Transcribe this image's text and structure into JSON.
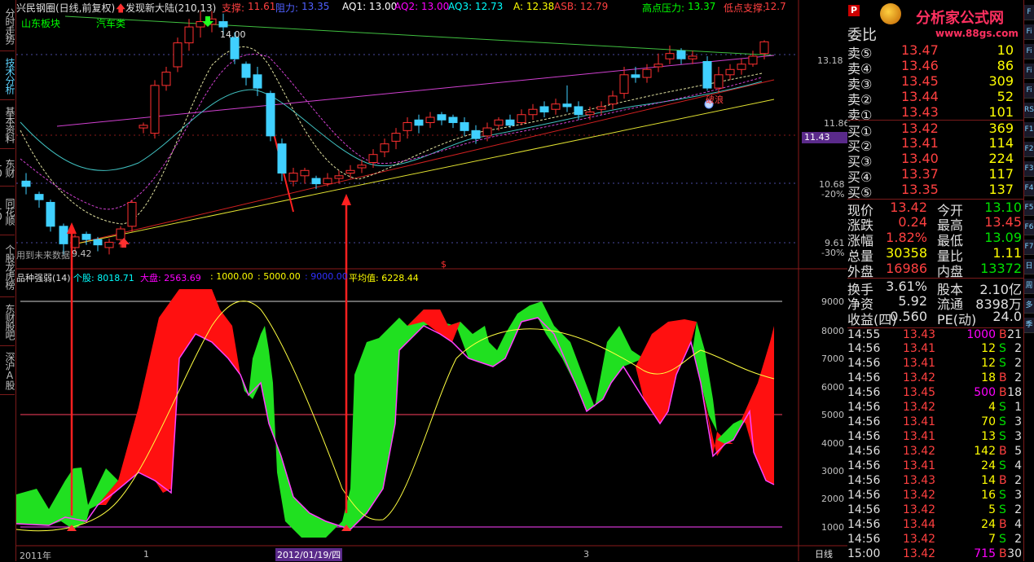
{
  "title": {
    "stock": "兴民钢圈(日线,前复权)",
    "indicator": "发现新大陆(210,13)",
    "support_label": "支撑:",
    "support_val": "11.61",
    "resist_label": "阻力:",
    "resist_val": "13.35",
    "aq1": "AQ1: 13.00",
    "aq2": "AQ2: 13.00",
    "aq3": "AQ3: 12.73",
    "a": "A: 12.38",
    "asb": "ASB: 12.79",
    "high_label": "高点压力:",
    "high_val": "13.37",
    "low_label": "低点支撑:",
    "low_val": "12.7"
  },
  "sector": [
    "山东板块",
    "汽车类"
  ],
  "left_tabs": [
    "分时走势",
    "技术分析",
    "基本资料",
    "东财10",
    "同花顺10",
    "个股龙虎榜",
    "东财股吧",
    "深沪A股"
  ],
  "main_chart": {
    "price_labels": [
      "13.18",
      "11.86",
      "10.68",
      "-20%",
      "9.61",
      "-30%"
    ],
    "current_price": "11.43",
    "peak_label": "14.00",
    "low_label": "9.42",
    "annot_bottom": "用到未来数据",
    "annot_right": "破浪"
  },
  "sub_chart": {
    "header": "品种强弱(14)",
    "stock_lbl": "个股: 8018.71",
    "market_lbl": "大盘: 2563.69",
    "l1000": ": 1000.00",
    "l5000": ": 5000.00",
    "l9000": ": 9000.00",
    "avg_lbl": "平均值: 6228.44",
    "y_labels": [
      "9000",
      "8000",
      "7000",
      "6000",
      "5000",
      "4000",
      "3000",
      "2000",
      "1000"
    ]
  },
  "x_axis": {
    "labels": [
      "2011年",
      "1",
      "2012/01/19/四",
      "3"
    ],
    "period": "日线"
  },
  "logo": {
    "brand": "分析家公式网",
    "url": "www.88gs.com",
    "badge": "P"
  },
  "orderbook": {
    "header": "委比",
    "sells": [
      {
        "label": "卖⑤",
        "price": "13.47",
        "vol": "10"
      },
      {
        "label": "卖④",
        "price": "13.46",
        "vol": "86"
      },
      {
        "label": "卖③",
        "price": "13.45",
        "vol": "309"
      },
      {
        "label": "卖②",
        "price": "13.44",
        "vol": "52"
      },
      {
        "label": "卖①",
        "price": "13.43",
        "vol": "101"
      }
    ],
    "buys": [
      {
        "label": "买①",
        "price": "13.42",
        "vol": "369"
      },
      {
        "label": "买②",
        "price": "13.41",
        "vol": "114"
      },
      {
        "label": "买③",
        "price": "13.40",
        "vol": "224"
      },
      {
        "label": "买④",
        "price": "13.37",
        "vol": "117"
      },
      {
        "label": "买⑤",
        "price": "13.35",
        "vol": "137"
      }
    ]
  },
  "quote": [
    {
      "l1": "现价",
      "v1": "13.42",
      "l2": "今开",
      "v2": "13.10"
    },
    {
      "l1": "涨跌",
      "v1": "0.24",
      "l2": "最高",
      "v2": "13.45"
    },
    {
      "l1": "涨幅",
      "v1": "1.82%",
      "l2": "最低",
      "v2": "13.09"
    },
    {
      "l1": "总量",
      "v1": "30358",
      "l2": "量比",
      "v2": "1.11"
    },
    {
      "l1": "外盘",
      "v1": "16986",
      "l2": "内盘",
      "v2": "13372"
    }
  ],
  "stats": [
    {
      "l1": "换手",
      "v1": "3.61%",
      "l2": "股本",
      "v2": "2.10亿"
    },
    {
      "l1": "净资",
      "v1": "5.92",
      "l2": "流通",
      "v2": "8398万"
    },
    {
      "l1": "收益(四)",
      "v1": "0.560",
      "l2": "PE(动)",
      "v2": "24.0"
    }
  ],
  "ticks": [
    {
      "t": "14:55",
      "p": "13.43",
      "v": "1000",
      "d": "B",
      "n": "21"
    },
    {
      "t": "14:56",
      "p": "13.41",
      "v": "12",
      "d": "S",
      "n": "2"
    },
    {
      "t": "14:56",
      "p": "13.41",
      "v": "12",
      "d": "S",
      "n": "2"
    },
    {
      "t": "14:56",
      "p": "13.42",
      "v": "18",
      "d": "B",
      "n": "2"
    },
    {
      "t": "14:56",
      "p": "13.45",
      "v": "500",
      "d": "B",
      "n": "18"
    },
    {
      "t": "14:56",
      "p": "13.42",
      "v": "4",
      "d": "S",
      "n": "1"
    },
    {
      "t": "14:56",
      "p": "13.41",
      "v": "70",
      "d": "S",
      "n": "3"
    },
    {
      "t": "14:56",
      "p": "13.41",
      "v": "13",
      "d": "S",
      "n": "3"
    },
    {
      "t": "14:56",
      "p": "13.42",
      "v": "142",
      "d": "B",
      "n": "5"
    },
    {
      "t": "14:56",
      "p": "13.41",
      "v": "24",
      "d": "S",
      "n": "4"
    },
    {
      "t": "14:56",
      "p": "13.43",
      "v": "14",
      "d": "B",
      "n": "2"
    },
    {
      "t": "14:56",
      "p": "13.42",
      "v": "16",
      "d": "S",
      "n": "3"
    },
    {
      "t": "14:56",
      "p": "13.42",
      "v": "5",
      "d": "S",
      "n": "2"
    },
    {
      "t": "14:56",
      "p": "13.44",
      "v": "24",
      "d": "B",
      "n": "4"
    },
    {
      "t": "14:56",
      "p": "13.42",
      "v": "7",
      "d": "S",
      "n": "2"
    },
    {
      "t": "15:00",
      "p": "13.42",
      "v": "715",
      "d": "B",
      "n": "30"
    }
  ],
  "far_right": [
    "F",
    "Fi",
    "Fi",
    "Fi",
    "Fi",
    "RS",
    "F1",
    "F2",
    "F3",
    "F4",
    "F5",
    "F6",
    "F7",
    "日",
    "周",
    "多",
    "季"
  ]
}
